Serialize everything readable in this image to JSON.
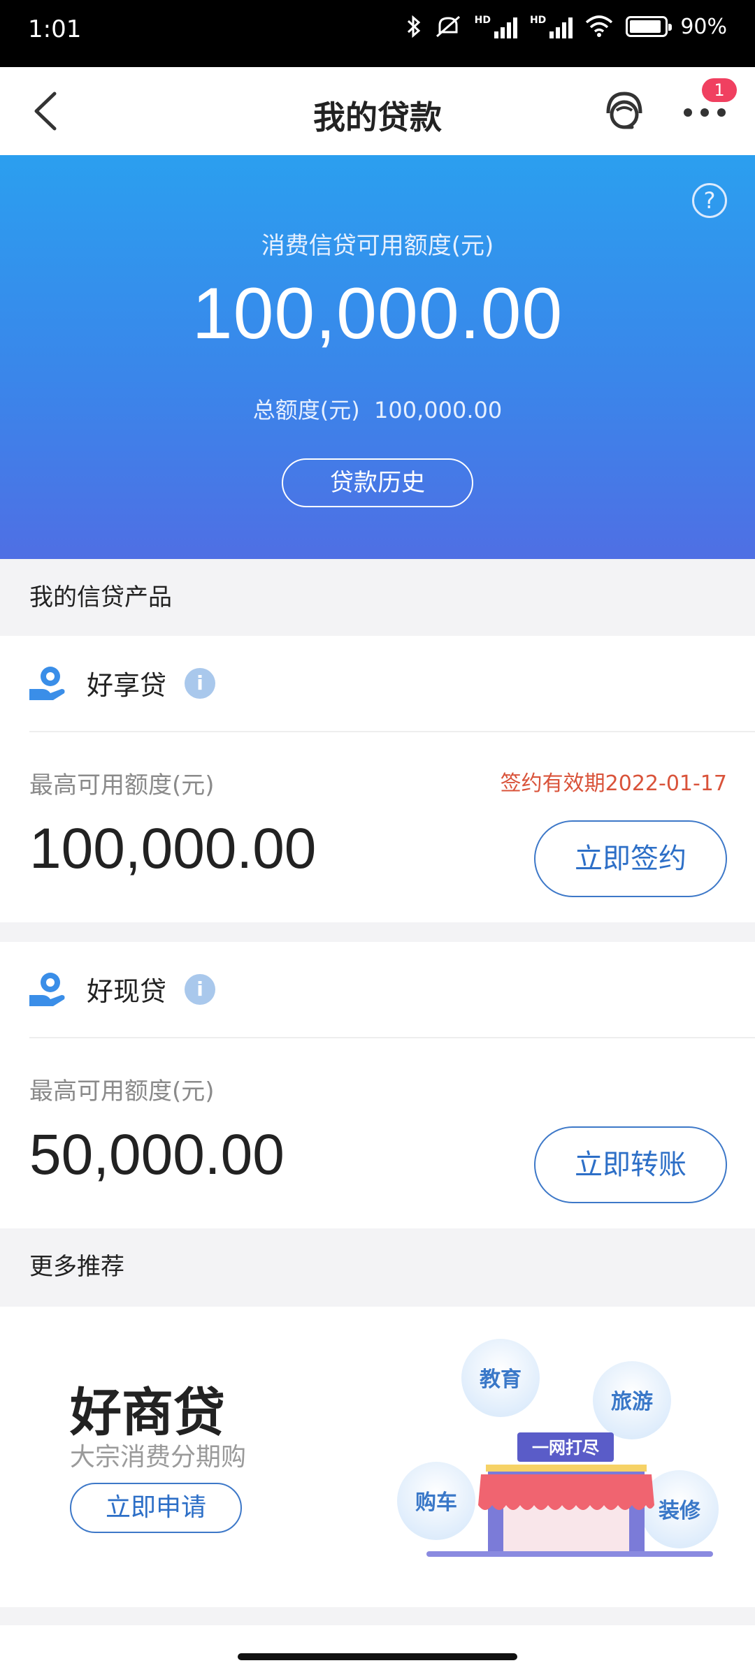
{
  "status_bar": {
    "time": "1:01",
    "battery": "90%",
    "hd1": "HD",
    "hd2": "HD"
  },
  "header": {
    "title": "我的贷款",
    "badge_count": "1"
  },
  "hero": {
    "label": "消费信贷可用额度(元)",
    "amount": "100,000.00",
    "total_label": "总额度(元)",
    "total_value": "100,000.00",
    "history_button": "贷款历史",
    "help": "?"
  },
  "section_products": "我的信贷产品",
  "products": [
    {
      "name": "好享贷",
      "info": "i",
      "limit_label": "最高可用额度(元)",
      "expiry": "签约有效期2022-01-17",
      "limit_value": "100,000.00",
      "action": "立即签约"
    },
    {
      "name": "好现贷",
      "info": "i",
      "limit_label": "最高可用额度(元)",
      "limit_value": "50,000.00",
      "action": "立即转账"
    }
  ],
  "section_more": "更多推荐",
  "promo": {
    "title": "好商贷",
    "subtitle": "大宗消费分期购",
    "apply": "立即申请",
    "tags": [
      "教育",
      "旅游",
      "购车",
      "装修"
    ],
    "banner": "一网打尽"
  }
}
